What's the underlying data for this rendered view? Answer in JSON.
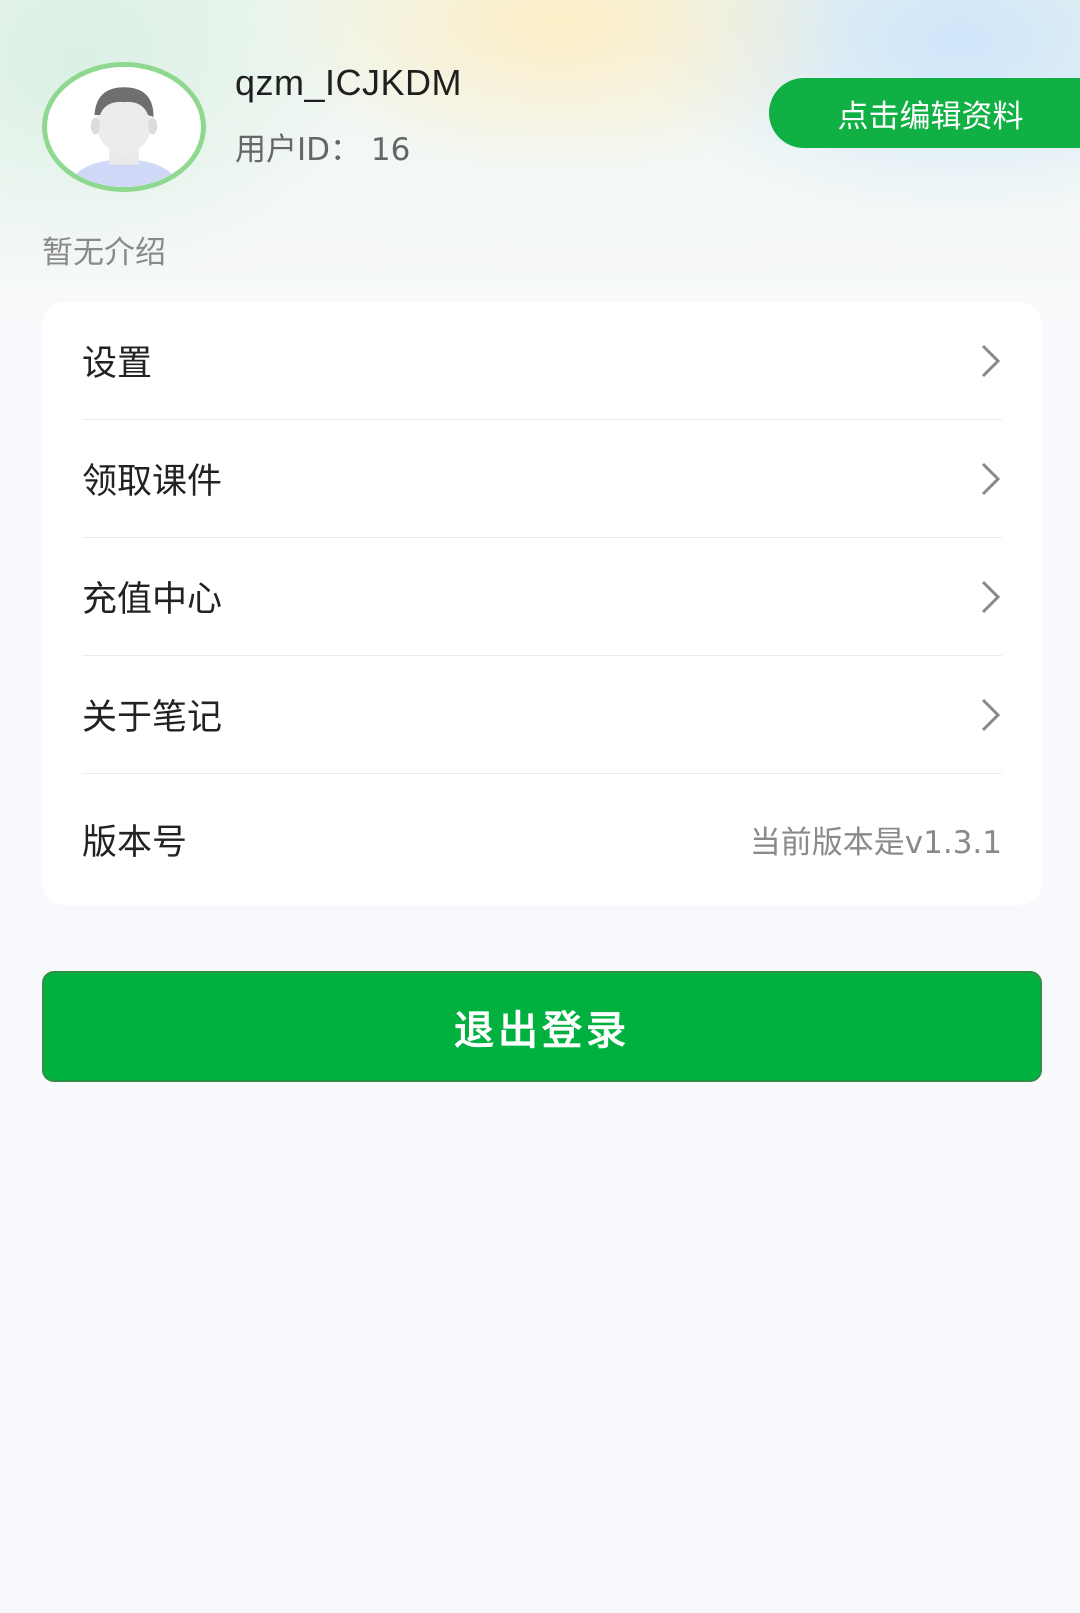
{
  "profile": {
    "username": "qzm_ICJKDM",
    "user_id": "用户ID： 16",
    "intro": "暂无介绍",
    "edit_button": "点击编辑资料"
  },
  "menu": {
    "items": [
      {
        "label": "设置",
        "icon": "chevron-right-icon"
      },
      {
        "label": "领取课件",
        "icon": "chevron-right-icon"
      },
      {
        "label": "充值中心",
        "icon": "chevron-right-icon"
      },
      {
        "label": "关于笔记",
        "icon": "chevron-right-icon"
      }
    ],
    "version": {
      "label": "版本号",
      "value": "当前版本是v1.3.1"
    }
  },
  "logout_button": "退出登录",
  "colors": {
    "accent": "#10b045",
    "logout": "#00b140",
    "avatar_ring": "#8fd88f",
    "background": "#f8f9fc"
  }
}
